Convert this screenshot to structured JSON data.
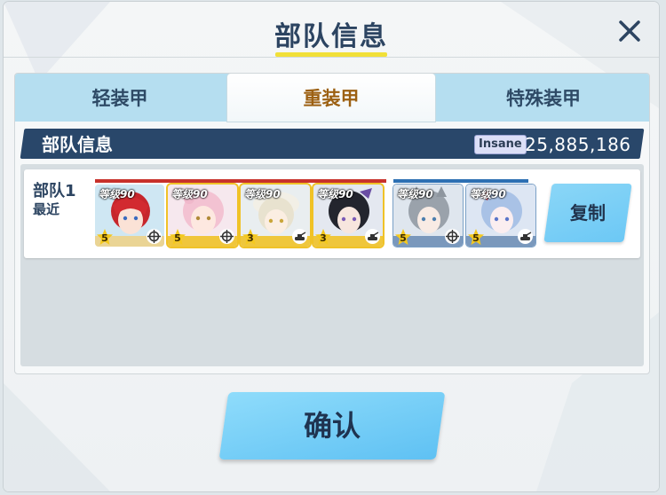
{
  "dialog": {
    "title": "部队信息"
  },
  "tabs": [
    {
      "label": "轻装甲",
      "active": false
    },
    {
      "label": "重装甲",
      "active": true
    },
    {
      "label": "特殊装甲",
      "active": false
    }
  ],
  "info_bar": {
    "label": "部队信息",
    "difficulty": "Insane",
    "score": "25,885,186"
  },
  "team": {
    "name": "部队1",
    "subtitle": "最近",
    "strikers": [
      {
        "level": "等级90",
        "stars": "5",
        "role": "crosshair-icon",
        "frame": "plain"
      },
      {
        "level": "等级90",
        "stars": "5",
        "role": "crosshair-icon",
        "frame": "gold"
      },
      {
        "level": "等级90",
        "stars": "3",
        "role": "tank-icon",
        "frame": "gold"
      },
      {
        "level": "等级90",
        "stars": "3",
        "role": "tank-icon",
        "frame": "gold"
      }
    ],
    "specials": [
      {
        "level": "等级90",
        "stars": "5",
        "role": "crosshair-icon",
        "frame": "blue"
      },
      {
        "level": "等级90",
        "stars": "5",
        "role": "tank-icon",
        "frame": "blue"
      }
    ],
    "copy_label": "复制"
  },
  "confirm_label": "确认",
  "colors": {
    "navy": "#29476a",
    "tab_bg": "#b5def0",
    "active_tab_text": "#9c6012",
    "accent_yellow": "#f1e038",
    "button_blue": "#6cc8f5",
    "striker_bar": "#c8312b",
    "special_bar": "#2c6fb3"
  }
}
